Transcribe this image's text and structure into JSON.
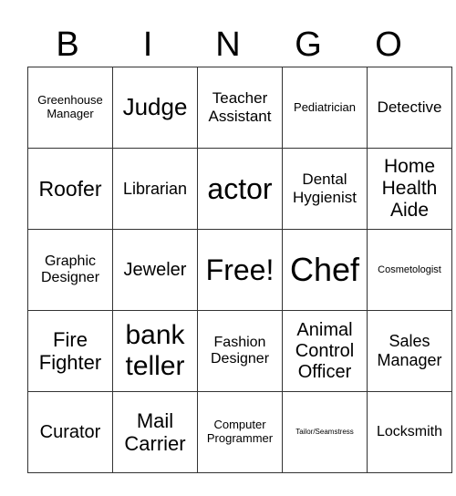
{
  "header": [
    "B",
    "I",
    "N",
    "G",
    "O"
  ],
  "cells": [
    [
      "Greenhouse Manager",
      "Judge",
      "Teacher Assistant",
      "Pediatrician",
      "Detective"
    ],
    [
      "Roofer",
      "Librarian",
      "actor",
      "Dental Hygienist",
      "Home Health Aide"
    ],
    [
      "Graphic Designer",
      "Jeweler",
      "Free!",
      "Chef",
      "Cosmetologist"
    ],
    [
      "Fire Fighter",
      "bank teller",
      "Fashion Designer",
      "Animal Control Officer",
      "Sales Manager"
    ],
    [
      "Curator",
      "Mail Carrier",
      "Computer Programmer",
      "Tailor/Seamstress",
      "Locksmith"
    ]
  ]
}
